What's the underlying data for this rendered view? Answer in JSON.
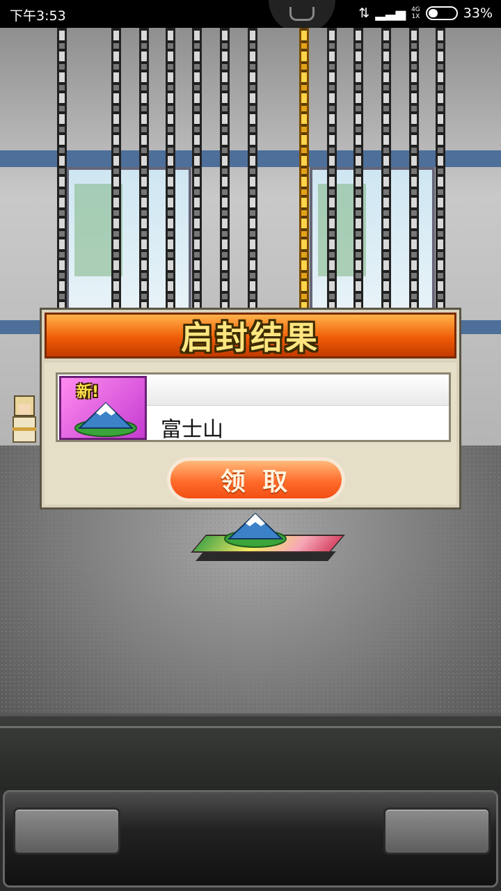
{
  "status_bar": {
    "time": "下午3:53",
    "network_top": "4G",
    "network_bottom": "1X",
    "battery": "33%",
    "battery_level": 0.33
  },
  "dialog": {
    "title": "启封结果",
    "item": {
      "badge": "新!",
      "name": "富士山",
      "icon": "mount-fuji-icon"
    },
    "claim_label": "领 取"
  },
  "colors": {
    "header_orange": "#f05d07",
    "title_yellow": "#ffe680",
    "claim_orange": "#ff6c2b",
    "icon_bg_magenta": "#c43bd0"
  }
}
